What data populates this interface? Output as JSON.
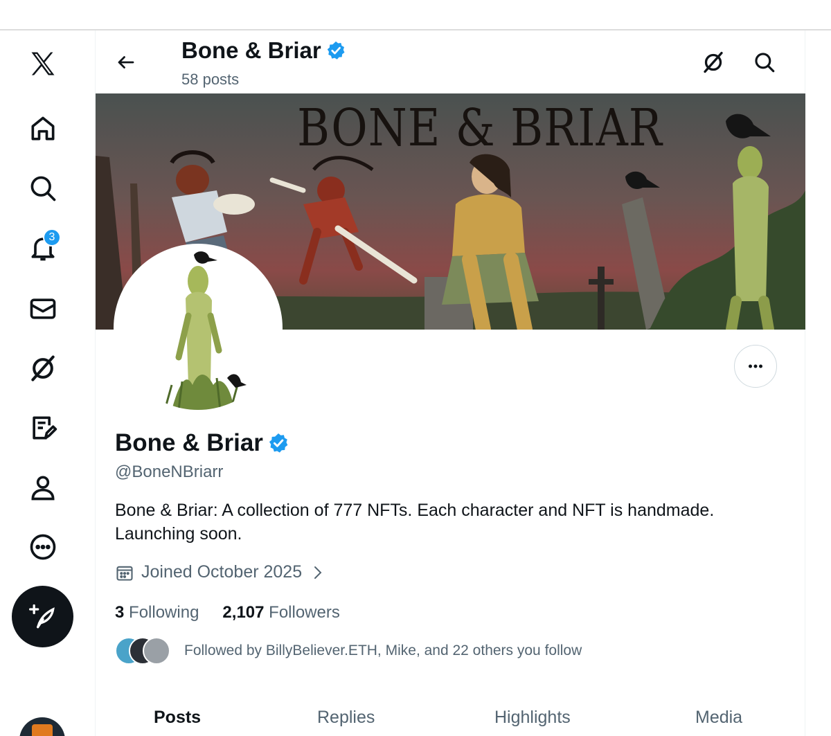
{
  "header": {
    "name": "Bone & Briar",
    "posts_count": "58 posts"
  },
  "banner": {
    "title_art": "BONE & BRIAR"
  },
  "sidebar": {
    "items": [
      {
        "icon": "x-logo-icon"
      },
      {
        "icon": "home-icon"
      },
      {
        "icon": "search-icon"
      },
      {
        "icon": "bell-icon",
        "badge": "3"
      },
      {
        "icon": "mail-icon"
      },
      {
        "icon": "grok-icon"
      },
      {
        "icon": "lists-icon"
      },
      {
        "icon": "profile-icon"
      },
      {
        "icon": "more-icon"
      }
    ],
    "post_button_icon": "compose-feather-icon"
  },
  "profile": {
    "name": "Bone & Briar",
    "handle": "@BoneNBriarr",
    "bio": "Bone & Briar: A collection of 777  NFTs. Each character and NFT is handmade. Launching soon.",
    "joined": "Joined October 2025",
    "following_count": "3",
    "following_label": "Following",
    "followers_count": "2,107",
    "followers_label": "Followers",
    "followed_by": "Followed by BillyBeliever.ETH, Mike, and 22 others you follow"
  },
  "tabs": [
    "Posts",
    "Replies",
    "Highlights",
    "Media"
  ],
  "colors": {
    "verified": "#1d9bf0",
    "text_primary": "#0f1419",
    "text_secondary": "#536471",
    "banner_sky_top": "#4a5150",
    "banner_sky_bottom": "#8a4a48"
  }
}
